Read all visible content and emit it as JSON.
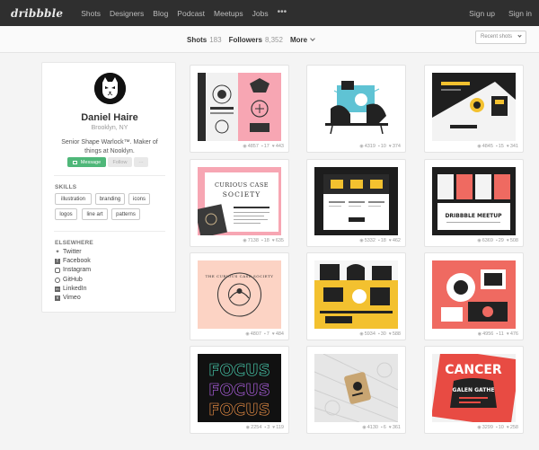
{
  "nav": {
    "logo": "dribbble",
    "links": [
      "Shots",
      "Designers",
      "Blog",
      "Podcast",
      "Meetups",
      "Jobs"
    ],
    "more": "•••",
    "signup": "Sign up",
    "signin": "Sign in"
  },
  "subnav": {
    "shots_label": "Shots",
    "shots_count": "183",
    "followers_label": "Followers",
    "followers_count": "8,352",
    "more_label": "More",
    "sort_value": "Recent shots"
  },
  "profile": {
    "name": "Daniel Haire",
    "location": "Brooklyn, NY",
    "bio": "Senior Shape Warlock™. Maker of things at Nooklyn.",
    "message_label": "Message",
    "follow_label": "Follow",
    "more_label": "···",
    "skills_heading": "SKILLS",
    "skills": [
      "illustration",
      "branding",
      "icons",
      "logos",
      "line art",
      "patterns"
    ],
    "elsewhere_heading": "ELSEWHERE",
    "links": [
      {
        "label": "Twitter",
        "icon": "twitter-icon"
      },
      {
        "label": "Facebook",
        "icon": "facebook-icon"
      },
      {
        "label": "Instagram",
        "icon": "instagram-icon"
      },
      {
        "label": "GitHub",
        "icon": "github-icon"
      },
      {
        "label": "LinkedIn",
        "icon": "linkedin-icon"
      },
      {
        "label": "Vimeo",
        "icon": "vimeo-icon"
      }
    ]
  },
  "colors": {
    "nav_bg": "#2f2f2f",
    "accent_green": "#4fb779",
    "pink": "#f7a6b3",
    "yellow": "#f3c12f",
    "coral": "#ef6a61"
  },
  "shots": [
    {
      "views": "4857",
      "comments": "17",
      "likes": "443"
    },
    {
      "views": "4319",
      "comments": "10",
      "likes": "374"
    },
    {
      "views": "4845",
      "comments": "15",
      "likes": "341"
    },
    {
      "views": "7138",
      "comments": "18",
      "likes": "635"
    },
    {
      "views": "5332",
      "comments": "18",
      "likes": "462"
    },
    {
      "views": "6369",
      "comments": "29",
      "likes": "508"
    },
    {
      "views": "4807",
      "comments": "7",
      "likes": "484"
    },
    {
      "views": "5934",
      "comments": "30",
      "likes": "588"
    },
    {
      "views": "4956",
      "comments": "11",
      "likes": "476"
    },
    {
      "views": "2254",
      "comments": "3",
      "likes": "119"
    },
    {
      "views": "4130",
      "comments": "6",
      "likes": "361"
    },
    {
      "views": "3299",
      "comments": "10",
      "likes": "258"
    }
  ],
  "shot_text": {
    "s4_title": "CURIOUS CASE SOCIETY",
    "s5_caption": "DRIBBBLE MEETUP",
    "s7_title": "THE CURIOUS CASE SOCIETY",
    "s10_word": "FOCUS",
    "s12_word": "CANCER",
    "s12_sub": "GALEN GATHE"
  }
}
